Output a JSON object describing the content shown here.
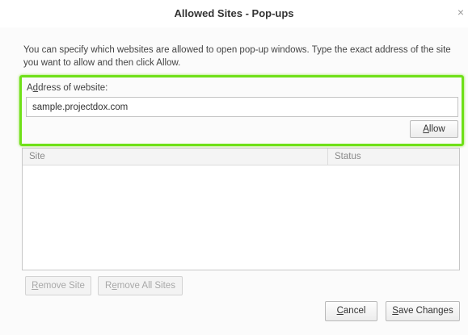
{
  "dialog": {
    "title": "Allowed Sites - Pop-ups",
    "close_glyph": "×",
    "description": "You can specify which websites are allowed to open pop-up windows. Type the exact address of the site you want to allow and then click Allow."
  },
  "address": {
    "label_accesskey": "d",
    "label_rest_before": "A",
    "label_rest_after": "dress of website:",
    "value": "sample.projectdox.com",
    "highlight_color": "#6fe018"
  },
  "buttons": {
    "allow_key": "A",
    "allow_rest": "llow",
    "remove_site_key": "R",
    "remove_site_rest": "emove Site",
    "remove_all_pre": "R",
    "remove_all_key": "e",
    "remove_all_rest": "move All Sites",
    "cancel_key": "C",
    "cancel_rest": "ancel",
    "save_key": "S",
    "save_rest": "ave Changes"
  },
  "table": {
    "columns": [
      "Site",
      "Status"
    ],
    "rows": []
  }
}
